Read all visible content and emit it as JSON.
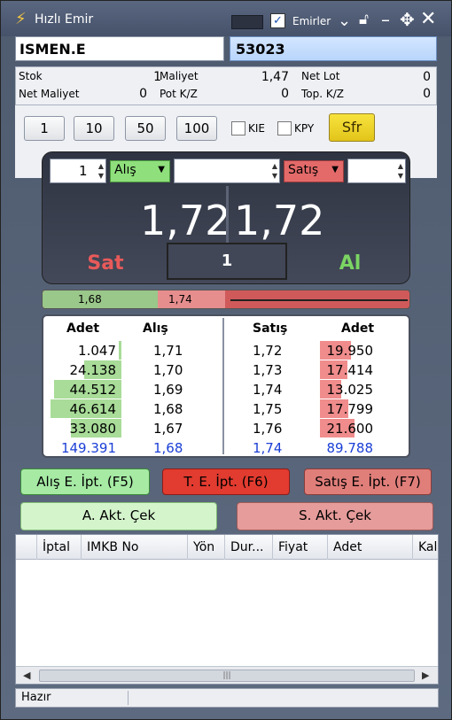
{
  "window": {
    "title": "Hızlı Emir",
    "emirler_label": "Emirler",
    "emirler_checked": true
  },
  "symbol": {
    "code": "ISMEN.E",
    "account": "53023"
  },
  "info": {
    "stok_label": "Stok",
    "stok_value": "1",
    "maliyet_label": "Maliyet",
    "maliyet_value": "1,47",
    "net_lot_label": "Net Lot",
    "net_lot_value": "0",
    "net_maliyet_label": "Net Maliyet",
    "net_maliyet_value": "0",
    "pot_kz_label": "Pot K/Z",
    "pot_kz_value": "0",
    "top_kz_label": "Top. K/Z",
    "top_kz_value": "0"
  },
  "controls": {
    "qty_buttons": [
      "1",
      "10",
      "50",
      "100"
    ],
    "kie_label": "KIE",
    "kpy_label": "KPY",
    "sfr_label": "Sfr"
  },
  "trade": {
    "lot_value": "1",
    "buy_select": "Alış",
    "sell_select": "Satış",
    "bid_price": "1,72",
    "ask_price": "1,72",
    "sell_button": "Sat",
    "quantity": "1",
    "buy_button": "Al"
  },
  "spread": {
    "bid": "1,68",
    "ask": "1,74",
    "bid_share": 0.31,
    "ask_share": 0.18
  },
  "order_book": {
    "headers": {
      "bid_qty": "Adet",
      "bid": "Alış",
      "ask": "Satış",
      "ask_qty": "Adet"
    },
    "rows": [
      {
        "bid_qty": "1.047",
        "bid": "1,71",
        "ask": "1,72",
        "ask_qty": "19.950",
        "bid_fill": 0.04,
        "ask_fill": 0.42
      },
      {
        "bid_qty": "24.138",
        "bid": "1,70",
        "ask": "1,73",
        "ask_qty": "17.414",
        "bid_fill": 0.52,
        "ask_fill": 0.37
      },
      {
        "bid_qty": "44.512",
        "bid": "1,69",
        "ask": "1,74",
        "ask_qty": "13.025",
        "bid_fill": 0.95,
        "ask_fill": 0.28
      },
      {
        "bid_qty": "46.614",
        "bid": "1,68",
        "ask": "1,75",
        "ask_qty": "17.799",
        "bid_fill": 1.0,
        "ask_fill": 0.38
      },
      {
        "bid_qty": "33.080",
        "bid": "1,67",
        "ask": "1,76",
        "ask_qty": "21.600",
        "bid_fill": 0.71,
        "ask_fill": 0.46
      }
    ],
    "totals": {
      "bid_qty": "149.391",
      "bid": "1,68",
      "ask": "1,74",
      "ask_qty": "89.788"
    }
  },
  "cancel_buttons": {
    "buy_cancel": "Alış E. İpt. (F5)",
    "all_cancel": "T. E. İpt. (F6)",
    "sell_cancel": "Satış E. İpt. (F7)",
    "buy_active": "A. Akt. Çek",
    "sell_active": "S. Akt. Çek"
  },
  "grid": {
    "columns": [
      "",
      "İptal",
      "IMKB No",
      "Yön",
      "Dur...",
      "Fiyat",
      "Adet",
      "Kala"
    ]
  },
  "status": {
    "text": "Hazır"
  },
  "colors": {
    "buy_green": "#8fe07c",
    "sell_red": "#e46a6a",
    "sfr_yellow": "#f0d42a",
    "book_total_blue": "#1b3fd6"
  }
}
